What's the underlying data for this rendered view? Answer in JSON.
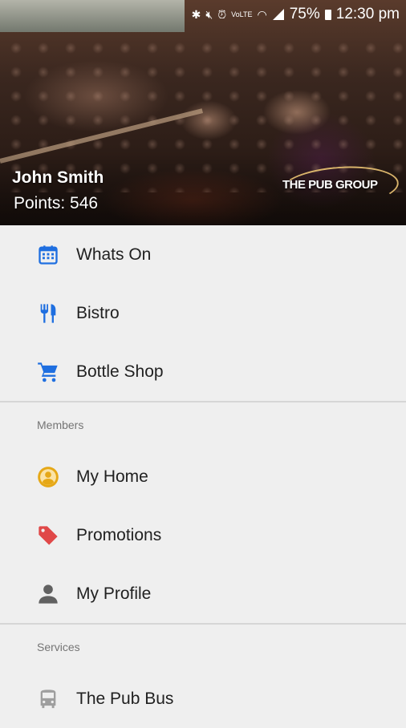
{
  "status_bar": {
    "battery": "75%",
    "time": "12:30 pm"
  },
  "header": {
    "user_name": "John Smith",
    "points": "Points: 546",
    "logo_text": "THE PUB GROUP"
  },
  "menu": {
    "main": [
      {
        "label": "Whats On",
        "icon": "calendar-icon",
        "color": "#1f6fe0"
      },
      {
        "label": "Bistro",
        "icon": "cutlery-icon",
        "color": "#1f6fe0"
      },
      {
        "label": "Bottle Shop",
        "icon": "cart-icon",
        "color": "#1f6fe0"
      }
    ],
    "members": {
      "title": "Members",
      "items": [
        {
          "label": "My Home",
          "icon": "account-circle-icon",
          "color": "#e6a817"
        },
        {
          "label": "Promotions",
          "icon": "tag-icon",
          "color": "#e04848"
        },
        {
          "label": "My Profile",
          "icon": "person-icon",
          "color": "#616161"
        }
      ]
    },
    "services": {
      "title": "Services",
      "items": [
        {
          "label": "The Pub Bus",
          "icon": "bus-icon",
          "color": "#9e9e9e"
        }
      ]
    }
  }
}
